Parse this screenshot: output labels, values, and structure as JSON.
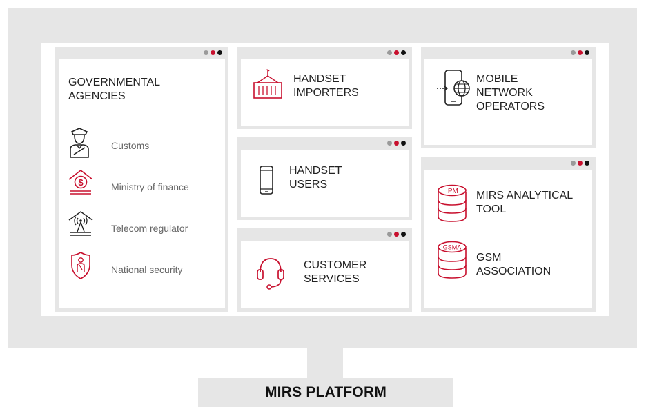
{
  "colors": {
    "accent": "#c8102e",
    "frame": "#e6e6e6",
    "dot_grey": "#9a9a9a",
    "dot_black": "#111111"
  },
  "platform_label": "MIRS PLATFORM",
  "governmental": {
    "title_lines": [
      "GOVERNMENTAL",
      "AGENCIES"
    ],
    "items": [
      {
        "icon": "customs-officer-icon",
        "label": "Customs"
      },
      {
        "icon": "ministry-finance-icon",
        "label": "Ministry of finance"
      },
      {
        "icon": "telecom-tower-icon",
        "label": "Telecom regulator"
      },
      {
        "icon": "security-shield-icon",
        "label": "National security"
      }
    ]
  },
  "importers": {
    "icon": "shipping-container-icon",
    "title_lines": [
      "HANDSET",
      "IMPORTERS"
    ]
  },
  "users": {
    "icon": "mobile-phone-icon",
    "title_lines": [
      "HANDSET",
      "USERS"
    ]
  },
  "services": {
    "icon": "headset-icon",
    "title_lines": [
      "CUSTOMER",
      "SERVICES"
    ]
  },
  "operators": {
    "icon": "phone-globe-icon",
    "title_lines": [
      "MOBILE",
      "NETWORK",
      "OPERATORS"
    ]
  },
  "analytics": {
    "items": [
      {
        "icon": "ipm-database-icon",
        "badge": "IPM",
        "title_lines": [
          "MIRS ANALYTICAL",
          "TOOL"
        ]
      },
      {
        "icon": "gsma-database-icon",
        "badge": "GSMA",
        "title_lines": [
          "GSM",
          "ASSOCIATION"
        ]
      }
    ]
  }
}
